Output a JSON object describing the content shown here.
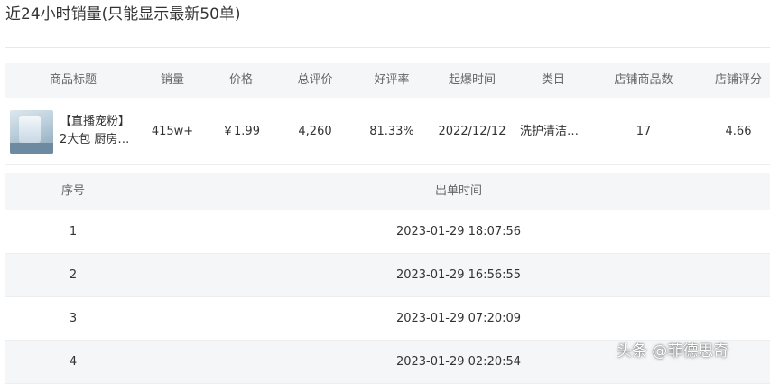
{
  "page": {
    "title": "近24小时销量(只能显示最新50单)"
  },
  "product_table": {
    "headers": [
      "商品标题",
      "销量",
      "价格",
      "总评价",
      "好评率",
      "起爆时间",
      "类目",
      "店铺商品数",
      "店铺评分"
    ],
    "row": {
      "title_line1": "【直播宠粉】",
      "title_line2": "2大包 厨房…",
      "sales": "415w+",
      "price": "￥1.99",
      "total_reviews": "4,260",
      "positive_rate": "81.33%",
      "burst_time": "2022/12/12",
      "category": "洗护清洁…",
      "shop_product_count": "17",
      "shop_score": "4.66"
    }
  },
  "order_table": {
    "headers": [
      "序号",
      "出单时间"
    ],
    "rows": [
      {
        "index": "1",
        "time": "2023-01-29 18:07:56"
      },
      {
        "index": "2",
        "time": "2023-01-29 16:56:55"
      },
      {
        "index": "3",
        "time": "2023-01-29 07:20:09"
      },
      {
        "index": "4",
        "time": "2023-01-29 02:20:54"
      }
    ]
  },
  "watermark": "头条 @菲德思奇"
}
